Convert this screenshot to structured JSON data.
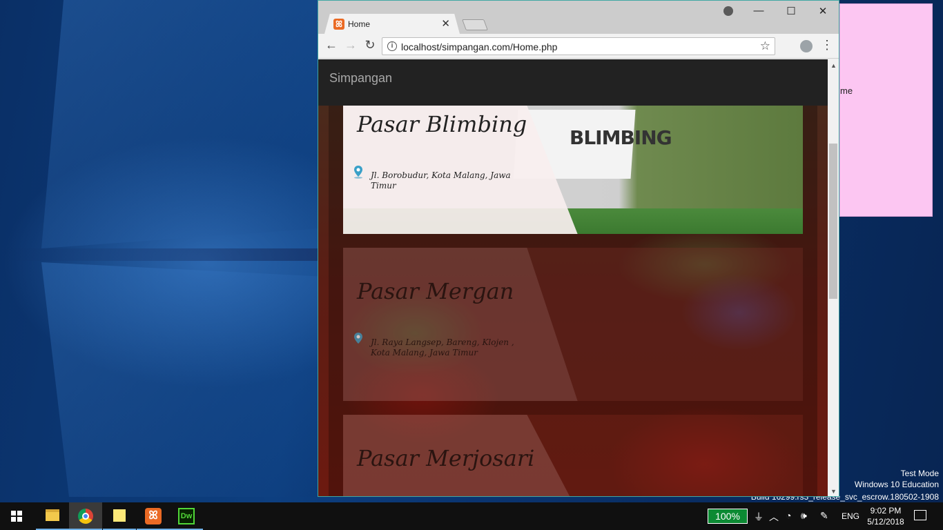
{
  "browser": {
    "tab_title": "Home",
    "url": "localhost/simpangan.com/Home.php"
  },
  "page": {
    "brand": "Simpangan",
    "cards": [
      {
        "title": "Pasar Blimbing",
        "address": "Jl. Borobudur, Kota Malang, Jawa Timur",
        "sign": "BLIMBING"
      },
      {
        "title": "Pasar Mergan",
        "address": "Jl. Raya Langsep, Bareng, Klojen , Kota Malang, Jawa Timur"
      },
      {
        "title": "Pasar Merjosari"
      }
    ]
  },
  "sticky_note": {
    "text": "me"
  },
  "watermark": {
    "line1": "Test Mode",
    "line2": "Windows 10 Education",
    "line3": "Build 16299.rs3_release_svc_escrow.180502-1908"
  },
  "taskbar": {
    "battery": "100%",
    "language": "ENG",
    "time": "9:02 PM",
    "date": "5/12/2018"
  },
  "icons": {
    "tab_favicon": "xampp-icon",
    "location": "map-pin-icon"
  },
  "colors": {
    "navbar": "#222222",
    "brand_text": "#a8a8a8",
    "window_border": "#3fa7a3",
    "battery": "#0c8a33"
  }
}
